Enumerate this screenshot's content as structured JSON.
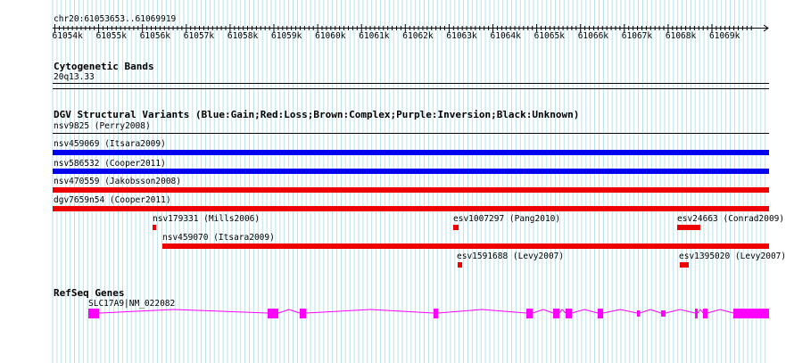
{
  "ruler": {
    "location": "chr20:61053653..61069919",
    "ticks": [
      "61054k",
      "61055k",
      "61056k",
      "61057k",
      "61058k",
      "61059k",
      "61060k",
      "61061k",
      "61062k",
      "61063k",
      "61064k",
      "61065k",
      "61066k",
      "61067k",
      "61068k",
      "61069k"
    ]
  },
  "cytobands": {
    "title": "Cytogenetic Bands",
    "band": "20q13.33"
  },
  "dgv": {
    "title": "DGV Structural Variants (Blue:Gain;Red:Loss;Brown:Complex;Purple:Inversion;Black:Unknown)",
    "colors": {
      "gain": "#0000ee",
      "loss": "#ee0000",
      "unknown": "#000000"
    },
    "variants": [
      {
        "label": "nsv9825 (Perry2008)",
        "type": "unknown"
      },
      {
        "label": "nsv459069 (Itsara2009)",
        "type": "gain"
      },
      {
        "label": "nsv586532 (Cooper2011)",
        "type": "gain"
      },
      {
        "label": "nsv470559 (Jakobsson2008)",
        "type": "loss"
      },
      {
        "label": "dgv7659n54 (Cooper2011)",
        "type": "loss"
      },
      {
        "label": "nsv179331 (Mills2006)",
        "type": "loss"
      },
      {
        "label": "esv1007297 (Pang2010)",
        "type": "loss"
      },
      {
        "label": "esv24663 (Conrad2009)",
        "type": "loss"
      },
      {
        "label": "nsv459070 (Itsara2009)",
        "type": "loss"
      },
      {
        "label": "esv1591688 (Levy2007)",
        "type": "loss"
      },
      {
        "label": "esv1395020 (Levy2007)",
        "type": "loss"
      }
    ]
  },
  "refseq": {
    "title": "RefSeq Genes",
    "gene_label": "SLC17A9|NM_022082",
    "color": "#ff00ff"
  }
}
